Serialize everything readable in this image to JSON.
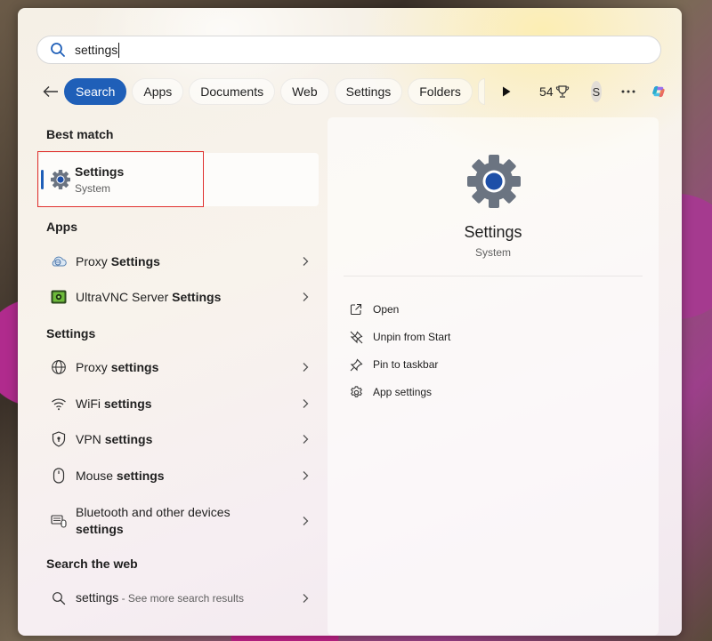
{
  "search": {
    "query": "settings"
  },
  "filters": {
    "back_label": "Back",
    "chips": [
      "Search",
      "Apps",
      "Documents",
      "Web",
      "Settings",
      "Folders"
    ],
    "active": "Search",
    "points": "54",
    "avatar_initial": "S"
  },
  "sections": {
    "best_match": "Best match",
    "apps": "Apps",
    "settings": "Settings",
    "web": "Search the web"
  },
  "best_match": {
    "title": "Settings",
    "subtitle": "System"
  },
  "apps": [
    {
      "prefix": "Proxy ",
      "bold": "Settings",
      "icon": "cloud-globe-icon"
    },
    {
      "prefix": "UltraVNC Server ",
      "bold": "Settings",
      "icon": "ultravnc-icon"
    }
  ],
  "settings_results": [
    {
      "prefix": "Proxy ",
      "bold": "settings",
      "icon": "globe-icon"
    },
    {
      "prefix": "WiFi ",
      "bold": "settings",
      "icon": "wifi-icon"
    },
    {
      "prefix": "VPN ",
      "bold": "settings",
      "icon": "shield-icon"
    },
    {
      "prefix": "Mouse ",
      "bold": "settings",
      "icon": "mouse-icon"
    },
    {
      "line1": "Bluetooth and other devices",
      "line2": "settings",
      "icon": "devices-icon"
    }
  ],
  "web_result": {
    "query": "settings",
    "hint": " - See more search results"
  },
  "preview": {
    "title": "Settings",
    "subtitle": "System",
    "actions": [
      {
        "label": "Open",
        "icon": "open-external-icon"
      },
      {
        "label": "Unpin from Start",
        "icon": "unpin-icon"
      },
      {
        "label": "Pin to taskbar",
        "icon": "pin-icon"
      },
      {
        "label": "App settings",
        "icon": "gear-icon"
      }
    ]
  },
  "colors": {
    "accent": "#1f5fb8",
    "highlight_border": "#e0312f"
  }
}
